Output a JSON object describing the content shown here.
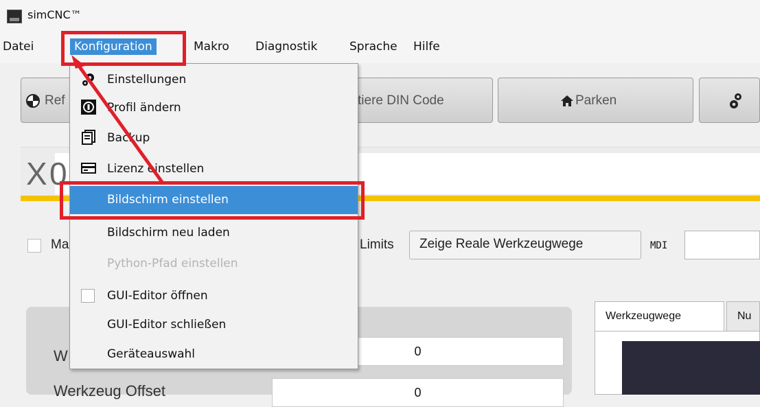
{
  "window": {
    "title": "simCNC™",
    "logo_text": "sim CNC"
  },
  "menubar": {
    "items": [
      "Datei",
      "Konfiguration",
      "Makro",
      "Diagnostik",
      "Sprache",
      "Hilfe"
    ]
  },
  "toolbar": {
    "ref_label": "Ref",
    "din_label": "tiere DIN Code",
    "park_label": "Parken"
  },
  "dro": {
    "axis_letter": "X",
    "value": "0"
  },
  "options": {
    "ma_label": "Ma",
    "limits_label": "Limits",
    "show_real_paths_button": "Zeige Reale Werkzeugwege",
    "mdi_label": "MDI"
  },
  "panel": {
    "row1_label": "W",
    "row1_value": "0",
    "row2_label": "Werkzeug Offset",
    "row2_value": "0"
  },
  "tabs": [
    "Werkzeugwege",
    "Nu"
  ],
  "dropdown": {
    "items": [
      {
        "label": "Einstellungen",
        "icon": "gear-icon"
      },
      {
        "label": "Profil ändern",
        "icon": "profile-icon"
      },
      {
        "label": "Backup",
        "icon": "backup-icon"
      },
      {
        "label": "Lizenz einstellen",
        "icon": "license-card-icon"
      },
      {
        "label": "Bildschirm einstellen",
        "icon": "",
        "state": "highlighted"
      },
      {
        "label": "Bildschirm neu laden",
        "icon": ""
      },
      {
        "label": "Python-Pfad einstellen",
        "icon": "",
        "state": "disabled"
      },
      {
        "label": "GUI-Editor öffnen",
        "icon": "checkbox-icon"
      },
      {
        "label": "GUI-Editor schließen",
        "icon": ""
      },
      {
        "label": "Geräteauswahl",
        "icon": ""
      }
    ]
  },
  "colors": {
    "accent": "#3c8ed7",
    "annotation_red": "#e0202a",
    "highlight_bar": "#f5c200"
  }
}
